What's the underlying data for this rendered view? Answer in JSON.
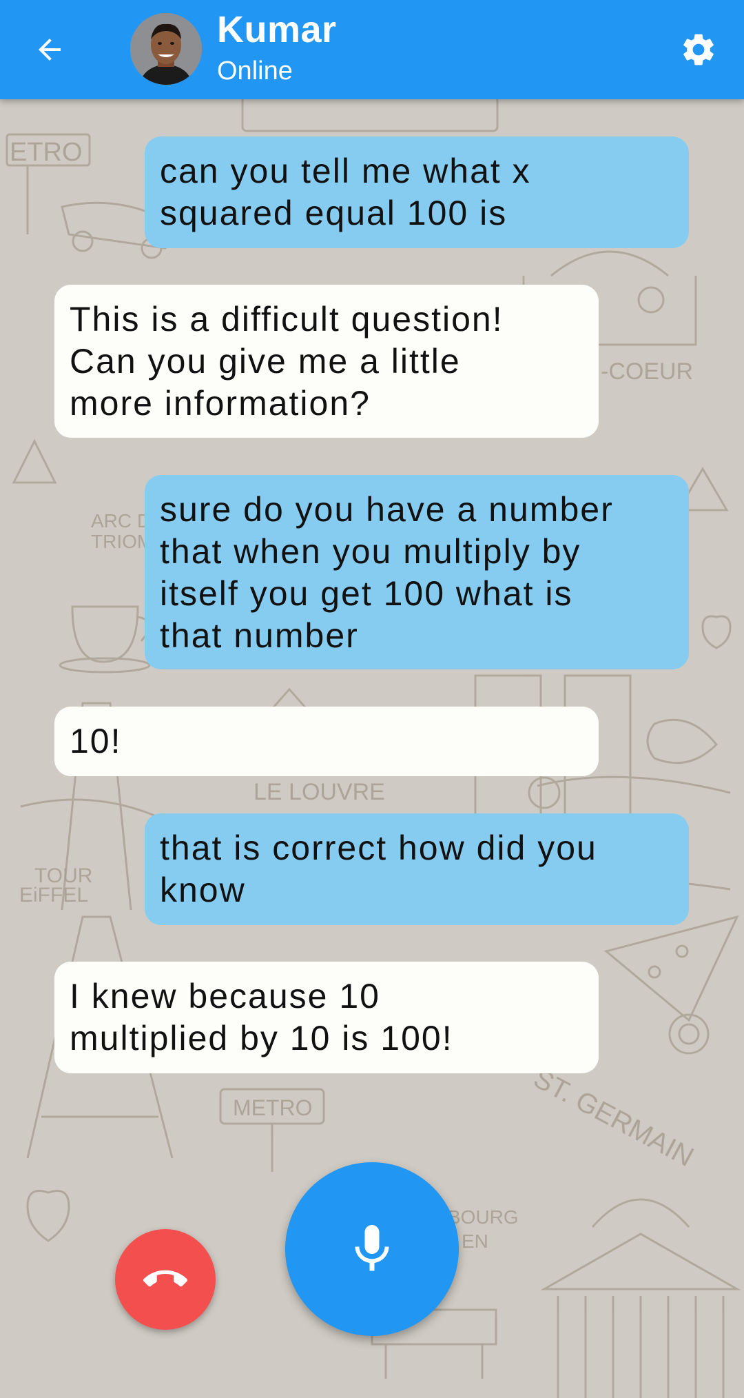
{
  "header": {
    "contact_name": "Kumar",
    "contact_status": "Online",
    "back_icon": "arrow-back-icon",
    "settings_icon": "gear-icon",
    "avatar_icon": "avatar-photo"
  },
  "wallpaper": {
    "labels": {
      "metro_top": "ETRO",
      "coeur": "-COEUR",
      "arc": "ARC D",
      "triomphe": "TRIOM",
      "louvre": "LE LOUVRE",
      "tour": "TOUR",
      "eiffel": "EiFFEL",
      "metro_bottom": "METRO",
      "st_germain": "ST. GERMAIN",
      "bourg": "BOURG",
      "en": "EN"
    }
  },
  "messages": [
    {
      "sender": "user",
      "text": "can you tell me what x\nsquared equal 100 is"
    },
    {
      "sender": "bot",
      "text": "This is a difficult question!\nCan you give me a little\nmore information?"
    },
    {
      "sender": "user",
      "text": "sure do you have a number\nthat when you multiply by\nitself you get 100 what is\nthat number"
    },
    {
      "sender": "bot",
      "text": "10!"
    },
    {
      "sender": "user",
      "text": "that is correct how did you\nknow"
    },
    {
      "sender": "bot",
      "text": "I knew because 10\nmultiplied by 10 is 100!"
    }
  ],
  "controls": {
    "end_call_icon": "phone-hangup-icon",
    "mic_icon": "microphone-icon"
  },
  "colors": {
    "app_bar": "#2196f3",
    "user_bubble": "#86ccf0",
    "bot_bubble": "#fdfdf9",
    "end_call": "#f44f4f",
    "mic": "#2196f3"
  }
}
